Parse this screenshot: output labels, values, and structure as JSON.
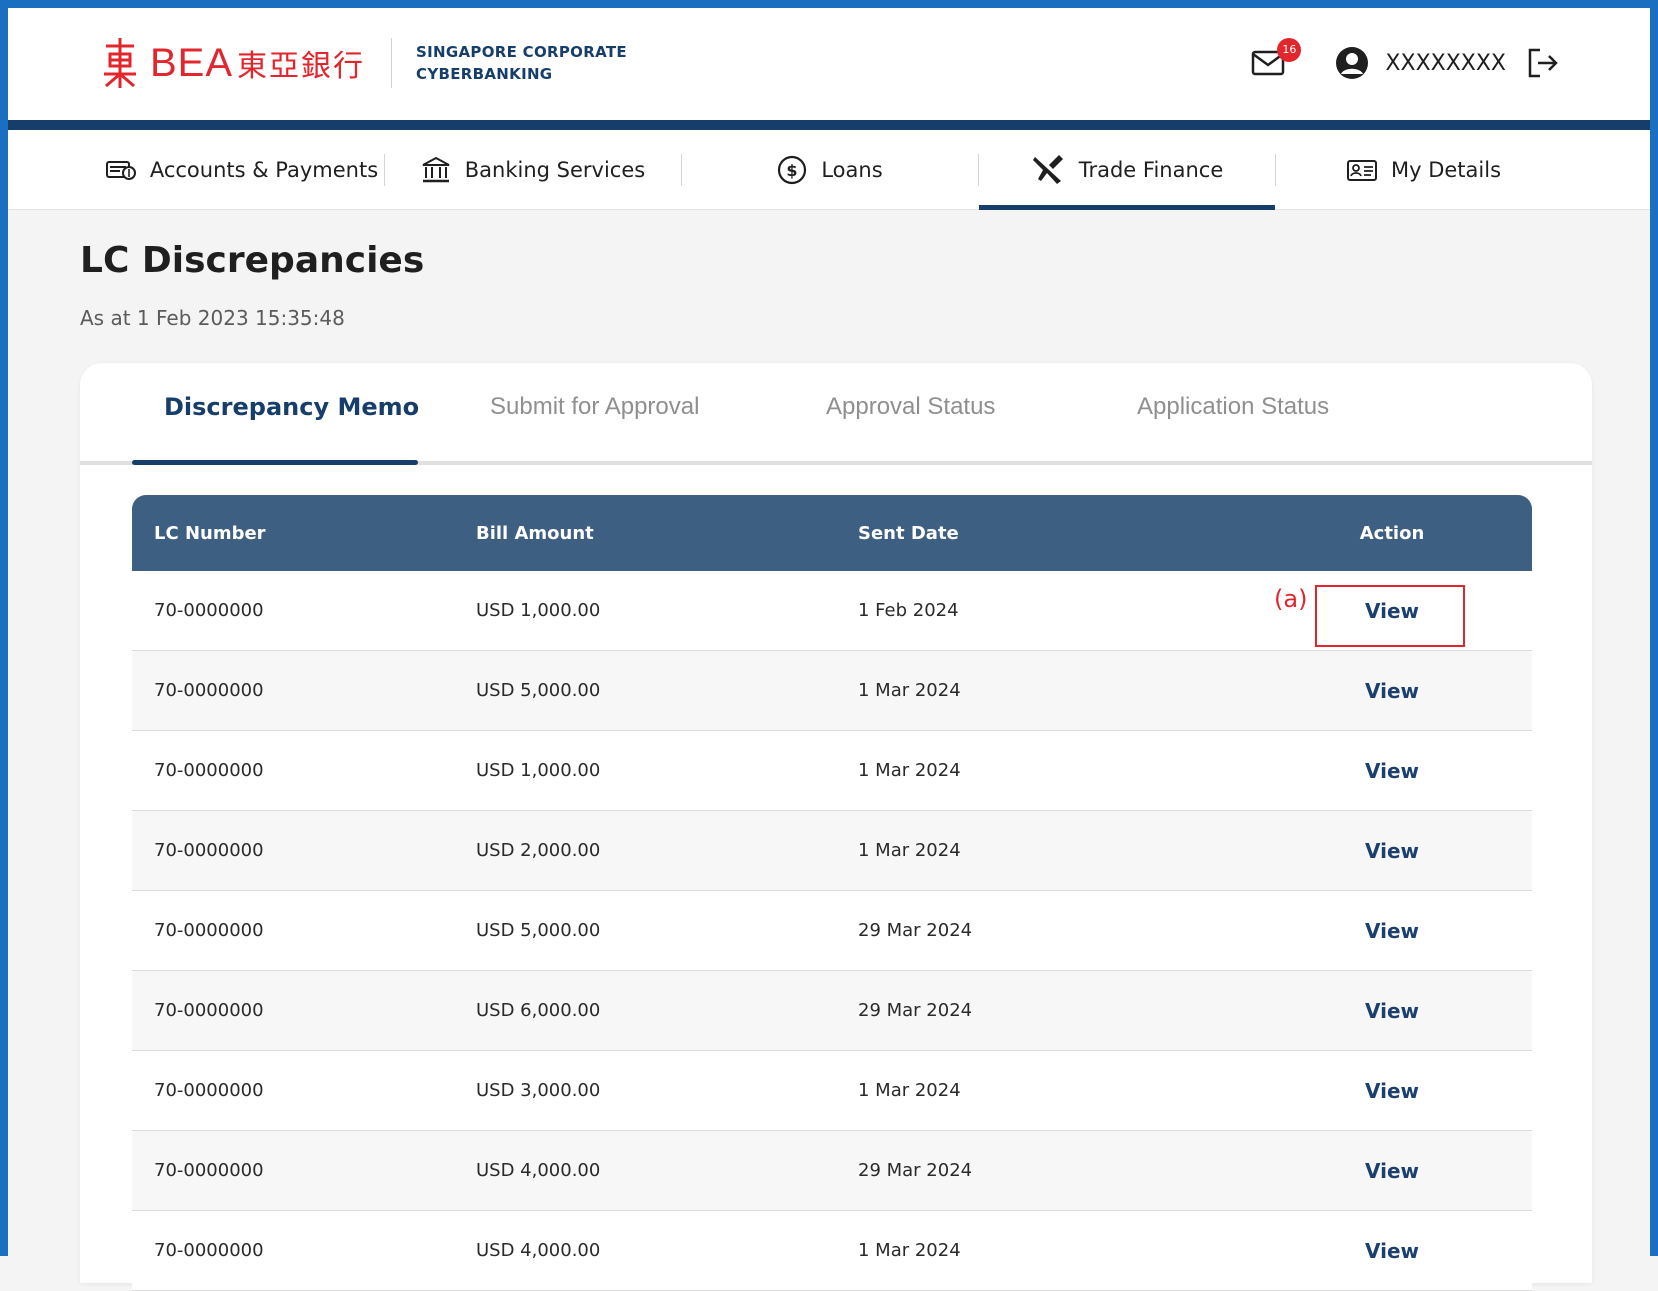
{
  "header": {
    "brand_name": "BEA",
    "brand_cn": "東亞銀行",
    "sub_line1": "SINGAPORE CORPORATE",
    "sub_line2": "CYBERBANKING",
    "mail_count": "16",
    "user_name": "XXXXXXXX"
  },
  "nav": [
    {
      "label": "Accounts & Payments",
      "icon": "wallet-icon"
    },
    {
      "label": "Banking Services",
      "icon": "bank-icon"
    },
    {
      "label": "Loans",
      "icon": "dollar-coin-icon"
    },
    {
      "label": "Trade Finance",
      "icon": "airplane-icon",
      "active": true
    },
    {
      "label": "My Details",
      "icon": "id-card-icon"
    }
  ],
  "page": {
    "title": "LC Discrepancies",
    "timestamp": "As at 1 Feb 2023 15:35:48"
  },
  "tabs": [
    {
      "label": "Discrepancy Memo",
      "active": true
    },
    {
      "label": "Submit for Approval"
    },
    {
      "label": "Approval Status"
    },
    {
      "label": "Application Status"
    }
  ],
  "table": {
    "headers": [
      "LC Number",
      "Bill Amount",
      "Sent Date",
      "Action"
    ],
    "rows": [
      {
        "lc": "70-0000000",
        "amount": "USD 1,000.00",
        "date": "1 Feb 2024",
        "action": "View"
      },
      {
        "lc": "70-0000000",
        "amount": "USD 5,000.00",
        "date": "1 Mar 2024",
        "action": "View"
      },
      {
        "lc": "70-0000000",
        "amount": "USD 1,000.00",
        "date": "1 Mar 2024",
        "action": "View"
      },
      {
        "lc": "70-0000000",
        "amount": "USD 2,000.00",
        "date": "1 Mar 2024",
        "action": "View"
      },
      {
        "lc": "70-0000000",
        "amount": "USD 5,000.00",
        "date": "29 Mar 2024",
        "action": "View"
      },
      {
        "lc": "70-0000000",
        "amount": "USD 6,000.00",
        "date": "29 Mar 2024",
        "action": "View"
      },
      {
        "lc": "70-0000000",
        "amount": "USD 3,000.00",
        "date": "1 Mar 2024",
        "action": "View"
      },
      {
        "lc": "70-0000000",
        "amount": "USD 4,000.00",
        "date": "29 Mar 2024",
        "action": "View"
      },
      {
        "lc": "70-0000000",
        "amount": "USD 4,000.00",
        "date": "1 Mar 2024",
        "action": "View"
      }
    ]
  },
  "annotation": {
    "label": "(a)"
  },
  "colors": {
    "brand_red": "#e1262d",
    "navy": "#173d6b",
    "table_header": "#3d5f82",
    "frame_blue": "#1a6fc0"
  }
}
